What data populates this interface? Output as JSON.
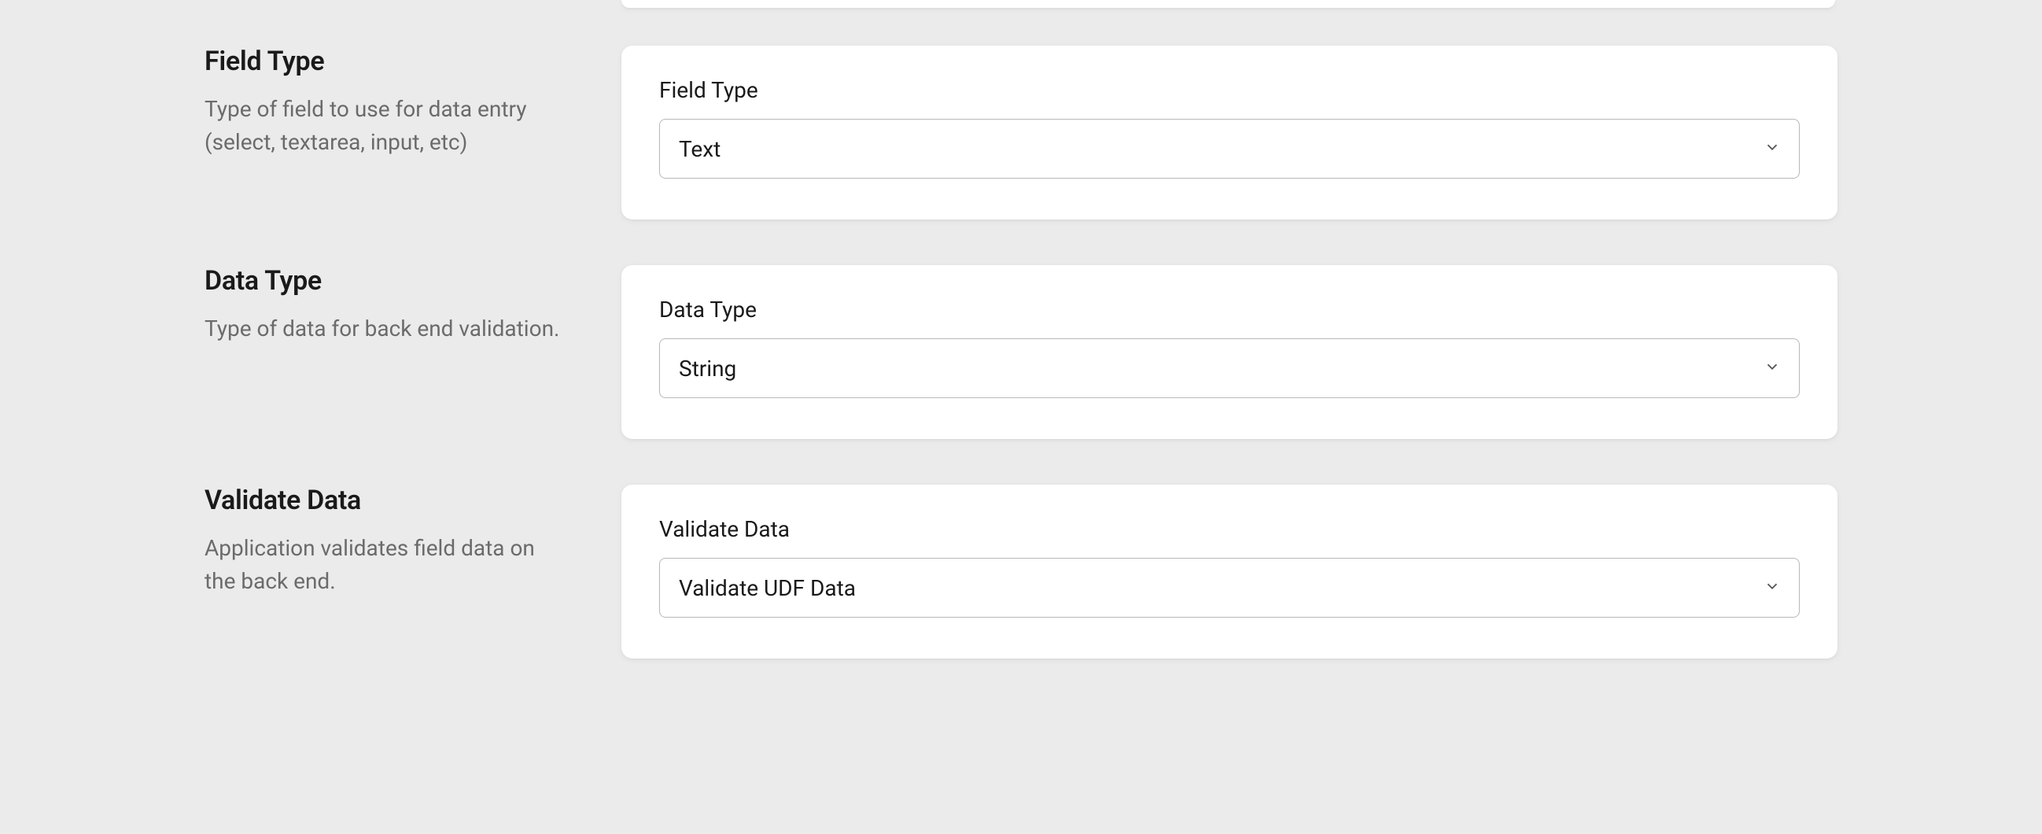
{
  "sections": {
    "fieldType": {
      "title": "Field Type",
      "description": "Type of field to use for data entry (select, textarea, input, etc)",
      "fieldLabel": "Field Type",
      "value": "Text"
    },
    "dataType": {
      "title": "Data Type",
      "description": "Type of data for back end validation.",
      "fieldLabel": "Data Type",
      "value": "String"
    },
    "validateData": {
      "title": "Validate Data",
      "description": "Application validates field data on the back end.",
      "fieldLabel": "Validate Data",
      "value": "Validate UDF Data"
    }
  }
}
